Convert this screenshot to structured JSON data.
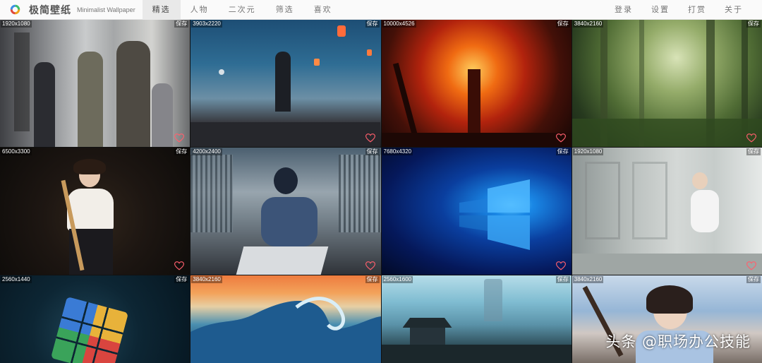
{
  "brand": {
    "title": "极简壁纸",
    "subtitle": "Minimalist Wallpaper",
    "logo_icon": "ring-logo-icon"
  },
  "nav": {
    "left": [
      {
        "label": "精选",
        "active": true
      },
      {
        "label": "人物",
        "active": false
      },
      {
        "label": "二次元",
        "active": false
      },
      {
        "label": "筛选",
        "active": false
      },
      {
        "label": "喜欢",
        "active": false
      }
    ],
    "right": [
      {
        "label": "登录"
      },
      {
        "label": "设置"
      },
      {
        "label": "打赏"
      },
      {
        "label": "关于"
      }
    ]
  },
  "wallpapers": [
    {
      "resolution": "1920x1080",
      "save_label": "保存",
      "heart": "heart-outline-icon"
    },
    {
      "resolution": "3903x2220",
      "save_label": "保存",
      "heart": "heart-outline-icon"
    },
    {
      "resolution": "10000x4526",
      "save_label": "保存",
      "heart": "heart-outline-icon"
    },
    {
      "resolution": "3840x2160",
      "save_label": "保存",
      "heart": "heart-outline-icon"
    },
    {
      "resolution": "6500x3300",
      "save_label": "保存",
      "heart": "heart-outline-icon"
    },
    {
      "resolution": "4200x2400",
      "save_label": "保存",
      "heart": "heart-outline-icon"
    },
    {
      "resolution": "7680x4320",
      "save_label": "保存",
      "heart": "heart-outline-icon"
    },
    {
      "resolution": "1920x1080",
      "save_label": "保存",
      "heart": "heart-outline-icon"
    },
    {
      "resolution": "2560x1440",
      "save_label": "保存",
      "heart": "heart-outline-icon"
    },
    {
      "resolution": "3840x2160",
      "save_label": "保存",
      "heart": "heart-outline-icon"
    },
    {
      "resolution": "2560x1600",
      "save_label": "保存",
      "heart": "heart-outline-icon"
    },
    {
      "resolution": "3840x2160",
      "save_label": "保存",
      "heart": "heart-outline-icon"
    }
  ],
  "watermark": "头条 @职场办公技能",
  "colors": {
    "heart": "#ff5f6d",
    "nav_text": "#777777",
    "nav_active_bg": "#e9e9e9"
  }
}
